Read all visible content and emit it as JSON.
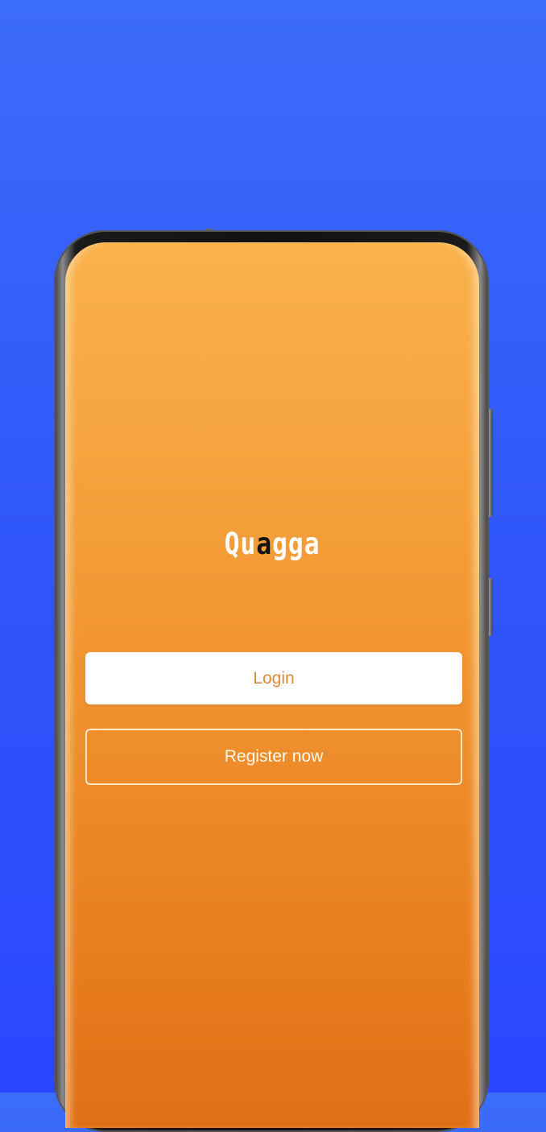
{
  "app": {
    "logo_part1": "Qu",
    "logo_part2": "a",
    "logo_part3": "gga"
  },
  "auth": {
    "login_label": "Login",
    "register_label": "Register now"
  },
  "colors": {
    "background": "#3258fa",
    "screen_top": "#fab24c",
    "screen_bottom": "#e06e16",
    "login_text": "#e08a3a",
    "button_border": "#ffe6c8"
  }
}
